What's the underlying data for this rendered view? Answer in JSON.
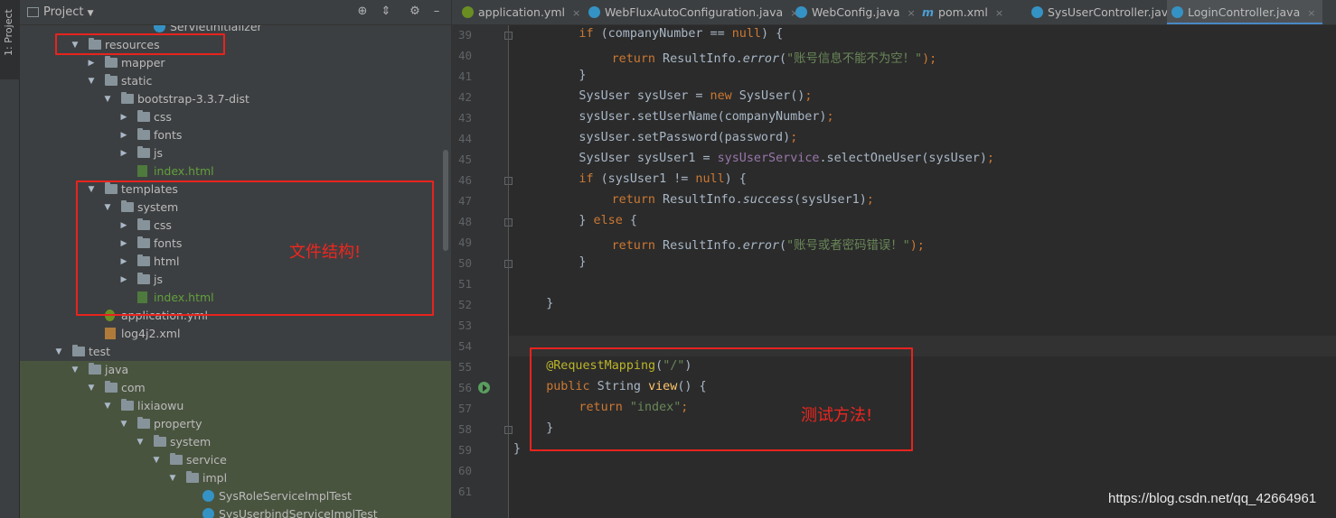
{
  "side_tab": {
    "label": "1: Project"
  },
  "project_panel": {
    "title": "Project",
    "icons": [
      "target-icon",
      "collapse-icon",
      "gear-icon",
      "minimize-icon"
    ]
  },
  "tree": [
    {
      "label": "ServletInitializer",
      "icon": "class-icon",
      "arrow": ""
    },
    {
      "label": "resources",
      "icon": "folder-icon",
      "arrow": "▼"
    },
    {
      "label": "mapper",
      "icon": "folder-icon",
      "arrow": "▶"
    },
    {
      "label": "static",
      "icon": "folder-icon",
      "arrow": "▼"
    },
    {
      "label": "bootstrap-3.3.7-dist",
      "icon": "folder-icon",
      "arrow": "▼"
    },
    {
      "label": "css",
      "icon": "folder-icon",
      "arrow": "▶"
    },
    {
      "label": "fonts",
      "icon": "folder-icon",
      "arrow": "▶"
    },
    {
      "label": "js",
      "icon": "folder-icon",
      "arrow": "▶"
    },
    {
      "label": "index.html",
      "icon": "html-file-icon",
      "arrow": ""
    },
    {
      "label": "templates",
      "icon": "folder-icon",
      "arrow": "▼"
    },
    {
      "label": "system",
      "icon": "folder-icon",
      "arrow": "▼"
    },
    {
      "label": "css",
      "icon": "folder-icon",
      "arrow": "▶"
    },
    {
      "label": "fonts",
      "icon": "folder-icon",
      "arrow": "▶"
    },
    {
      "label": "html",
      "icon": "folder-icon",
      "arrow": "▶"
    },
    {
      "label": "js",
      "icon": "folder-icon",
      "arrow": "▶"
    },
    {
      "label": "index.html",
      "icon": "html-file-icon",
      "arrow": ""
    },
    {
      "label": "application.yml",
      "icon": "yml-file-icon",
      "arrow": ""
    },
    {
      "label": "log4j2.xml",
      "icon": "xml-file-icon",
      "arrow": ""
    },
    {
      "label": "test",
      "icon": "folder-icon",
      "arrow": "▼"
    },
    {
      "label": "java",
      "icon": "folder-icon",
      "arrow": "▼"
    },
    {
      "label": "com",
      "icon": "folder-icon",
      "arrow": "▼"
    },
    {
      "label": "lixiaowu",
      "icon": "folder-icon",
      "arrow": "▼"
    },
    {
      "label": "property",
      "icon": "folder-icon",
      "arrow": "▼"
    },
    {
      "label": "system",
      "icon": "folder-icon",
      "arrow": "▼"
    },
    {
      "label": "service",
      "icon": "folder-icon",
      "arrow": "▼"
    },
    {
      "label": "impl",
      "icon": "folder-icon",
      "arrow": "▼"
    },
    {
      "label": "SysRoleServiceImplTest",
      "icon": "class-icon",
      "arrow": ""
    },
    {
      "label": "SysUserbindServiceImplTest",
      "icon": "class-icon",
      "arrow": ""
    }
  ],
  "tabs": [
    {
      "label": "application.yml",
      "icon": "yml-icon"
    },
    {
      "label": "WebFluxAutoConfiguration.java",
      "icon": "class-icon"
    },
    {
      "label": "WebConfig.java",
      "icon": "class-icon"
    },
    {
      "label": "pom.xml",
      "icon": "maven-icon",
      "prefix": "m"
    },
    {
      "label": "SysUserController.java",
      "icon": "class-icon"
    },
    {
      "label": "LoginController.java",
      "icon": "class-icon",
      "active": true
    }
  ],
  "line_numbers": [
    "39",
    "40",
    "41",
    "42",
    "43",
    "44",
    "45",
    "46",
    "47",
    "48",
    "49",
    "50",
    "51",
    "52",
    "53",
    "54",
    "55",
    "56",
    "57",
    "58",
    "59",
    "60",
    "61"
  ],
  "code_strings": {
    "l39_a": "if",
    "l39_b": " (companyNumber == ",
    "l39_c": "null",
    "l39_d": ") {",
    "l40_a": "return",
    "l40_b": " ResultInfo.",
    "l40_c": "error",
    "l40_d": "(",
    "l40_e": "\"账号信息不能不为空！\"",
    "l40_f": ");",
    "l41": "}",
    "l42_a": "SysUser sysUser = ",
    "l42_b": "new",
    "l42_c": " SysUser()",
    "l42_d": ";",
    "l43_a": "sysUser.setUserName(companyNumber)",
    "l43_b": ";",
    "l44_a": "sysUser.setPassword(password)",
    "l44_b": ";",
    "l45_a": "SysUser sysUser1 = ",
    "l45_b": "sysUserService",
    "l45_c": ".selectOneUser(sysUser)",
    "l45_d": ";",
    "l46_a": "if",
    "l46_b": " (sysUser1 != ",
    "l46_c": "null",
    "l46_d": ") {",
    "l47_a": "return",
    "l47_b": " ResultInfo.",
    "l47_c": "success",
    "l47_d": "(sysUser1)",
    "l47_e": ";",
    "l48_a": "} ",
    "l48_b": "else",
    "l48_c": " {",
    "l49_a": "return",
    "l49_b": " ResultInfo.",
    "l49_c": "error",
    "l49_d": "(",
    "l49_e": "\"账号或者密码错误！\"",
    "l49_f": ");",
    "l50": "}",
    "l52": "}",
    "l55_a": "@RequestMapping",
    "l55_b": "(",
    "l55_c": "\"/\"",
    "l55_d": ")",
    "l56_a": "public",
    "l56_b": " String ",
    "l56_c": "view",
    "l56_d": "() {",
    "l57_a": "return",
    "l57_b": " \"index\"",
    "l57_c": ";",
    "l58": "}",
    "l59": "}"
  },
  "annotations": {
    "file_structure": "文件结构!",
    "test_method": "测试方法!"
  },
  "watermark": "https://blog.csdn.net/qq_42664961",
  "colors": {
    "keyword": "#cc7832",
    "string": "#6a8759",
    "field": "#9876aa",
    "annotation": "#bbb529",
    "method_decl": "#ffc66d",
    "highlight_box": "#e8231e"
  }
}
